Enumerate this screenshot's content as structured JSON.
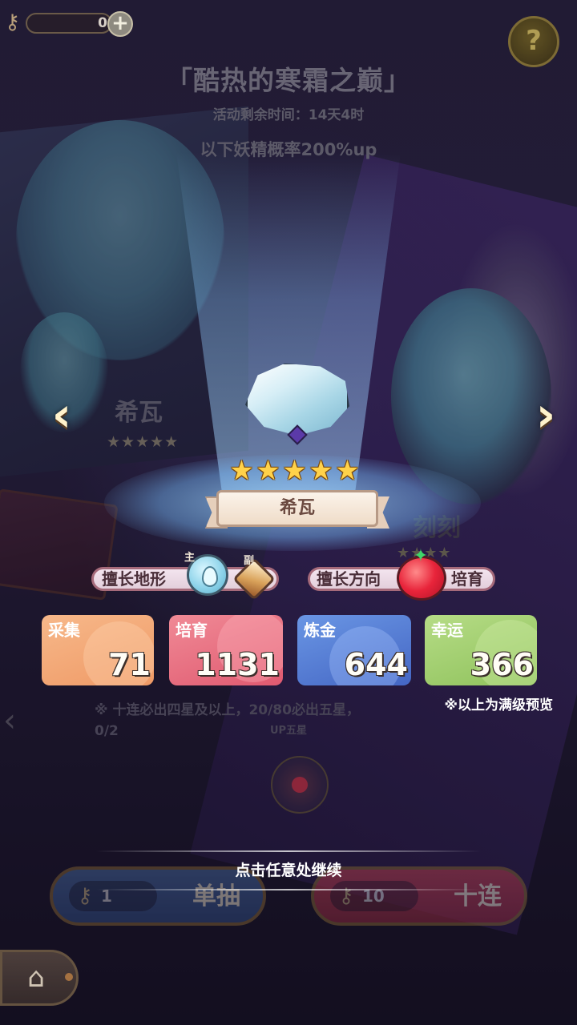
{
  "topbar": {
    "key_count": "0",
    "plus_label": "+",
    "help_label": "?"
  },
  "event": {
    "title": "「酷热的寒霜之巅」",
    "remaining_time": "活动剩余时间：14天4时",
    "rate_up": "以下妖精概率200%up"
  },
  "banner": {
    "left_fairy_name": "希瓦",
    "left_fairy_stars": "★★★★★",
    "right_fairy_name": "刻刻",
    "right_fairy_stars": "★★★★"
  },
  "result": {
    "fairy_name": "希瓦",
    "stars": [
      "★",
      "★",
      "★",
      "★",
      "★"
    ]
  },
  "specialty": {
    "terrain_label": "擅长地形",
    "terrain_main_tag": "主",
    "terrain_sub_tag": "副",
    "terrain_main_icon": "water-drop-icon",
    "terrain_sub_icon": "amber-crystal-icon",
    "direction_label": "擅长方向",
    "direction_icon": "tomato-icon",
    "direction_value": "培育"
  },
  "stats": [
    {
      "label": "采集",
      "value": "71",
      "color": "#f7b88a"
    },
    {
      "label": "培育",
      "value": "1131",
      "color": "#f08a96"
    },
    {
      "label": "炼金",
      "value": "644",
      "color": "#6a96e4"
    },
    {
      "label": "幸运",
      "value": "366",
      "color": "#b6dc86"
    }
  ],
  "notes": {
    "preview": "※以上为满级预览",
    "rules_line1": "※ 十连必出四星及以上，20/80必出五星，0/2",
    "rules_line2": "UP五星"
  },
  "continue_hint": "点击任意处继续",
  "draw": {
    "single_cost": "1",
    "single_label": "单抽",
    "ten_cost": "10",
    "ten_label": "十连"
  },
  "icons": {
    "key": "key-icon",
    "home": "home-icon",
    "arrow_left": "chevron-left-icon",
    "arrow_right": "chevron-right-icon"
  }
}
